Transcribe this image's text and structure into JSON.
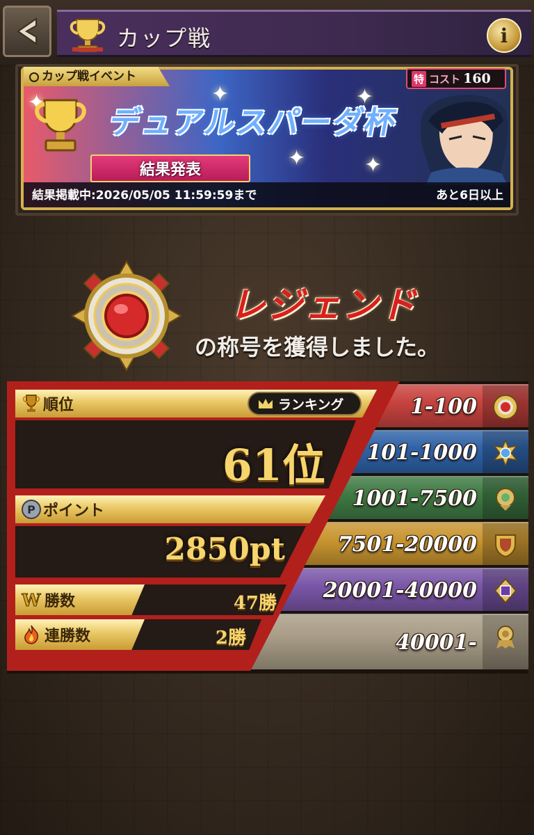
{
  "header": {
    "title": "カップ戦",
    "back_icon": "back-arrow-icon",
    "info_icon": "info-icon",
    "info_label": "i"
  },
  "event": {
    "tab_label": "カップ戦イベント",
    "cost_special": "特",
    "cost_label": "コスト",
    "cost_value": "160",
    "logo_text": "デュアルスパーダ杯",
    "result_label": "結果発表",
    "period": "結果掲載中:2026/05/05 11:59:59まで",
    "remaining": "あと6日以上"
  },
  "title_award": {
    "name": "レジェンド",
    "message": "の称号を獲得しました。"
  },
  "results": {
    "rank_label": "順位",
    "ranking_button": "ランキング",
    "rank_value": "61位",
    "point_label": "ポイント",
    "point_value": "2850pt",
    "wins_label": "勝数",
    "wins_value": "47勝",
    "streak_label": "連勝数",
    "streak_value": "2勝"
  },
  "tiers": [
    {
      "range": "1-100",
      "color": "#c7433f",
      "icon": "legend-medal-icon"
    },
    {
      "range": "101-1000",
      "color": "#2f63a8",
      "icon": "blue-medal-icon"
    },
    {
      "range": "1001-7500",
      "color": "#3f7a44",
      "icon": "green-medal-icon"
    },
    {
      "range": "7501-20000",
      "color": "#c99530",
      "icon": "gold-shield-icon"
    },
    {
      "range": "20001-40000",
      "color": "#7a56a8",
      "icon": "purple-badge-icon"
    },
    {
      "range": "40001-",
      "color": "#a89c86",
      "icon": "bronze-ribbon-icon"
    }
  ]
}
